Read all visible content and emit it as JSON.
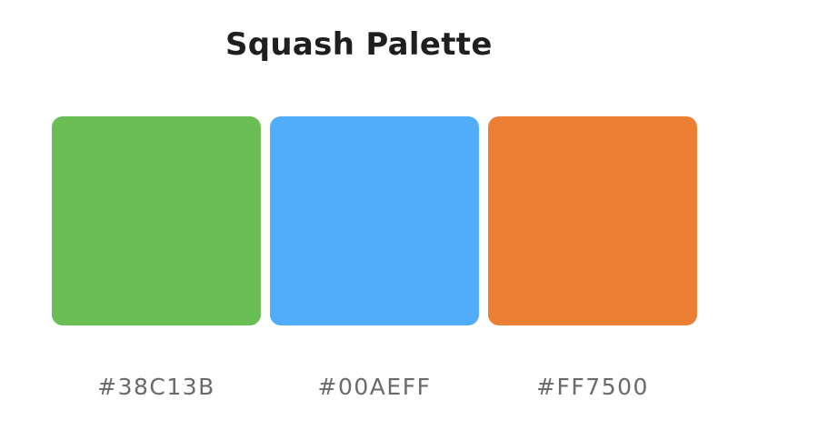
{
  "title": "Squash Palette",
  "palette": [
    {
      "hex": "#38C13B",
      "display_color": "#69BF53"
    },
    {
      "hex": "#00AEFF",
      "display_color": "#51ACFA"
    },
    {
      "hex": "#FF7500",
      "display_color": "#EC7F34"
    }
  ]
}
